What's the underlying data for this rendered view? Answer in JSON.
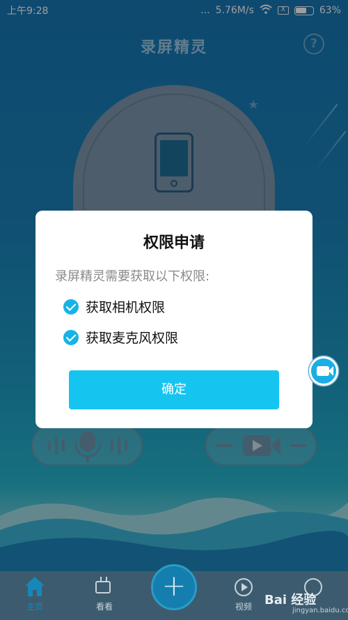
{
  "status_bar": {
    "time": "上午9:28",
    "signal": "...",
    "speed": "5.76M/s",
    "sim": "X",
    "battery": "63%"
  },
  "header": {
    "title": "录屏精灵",
    "help": "?"
  },
  "dialog": {
    "title": "权限申请",
    "description": "录屏精灵需要获取以下权限:",
    "permissions": [
      {
        "label": "获取相机权限"
      },
      {
        "label": "获取麦克风权限"
      }
    ],
    "confirm_label": "确定"
  },
  "bottom_nav": {
    "home_label": "主页",
    "watch_label": "看看",
    "add_label": "+",
    "video_label": "视频"
  },
  "watermark": {
    "brand": "Bai 经验",
    "url": "jingyan.baidu.com"
  },
  "colors": {
    "accent": "#16c4f0",
    "check": "#16b3e6",
    "home_active": "#1688b8"
  }
}
